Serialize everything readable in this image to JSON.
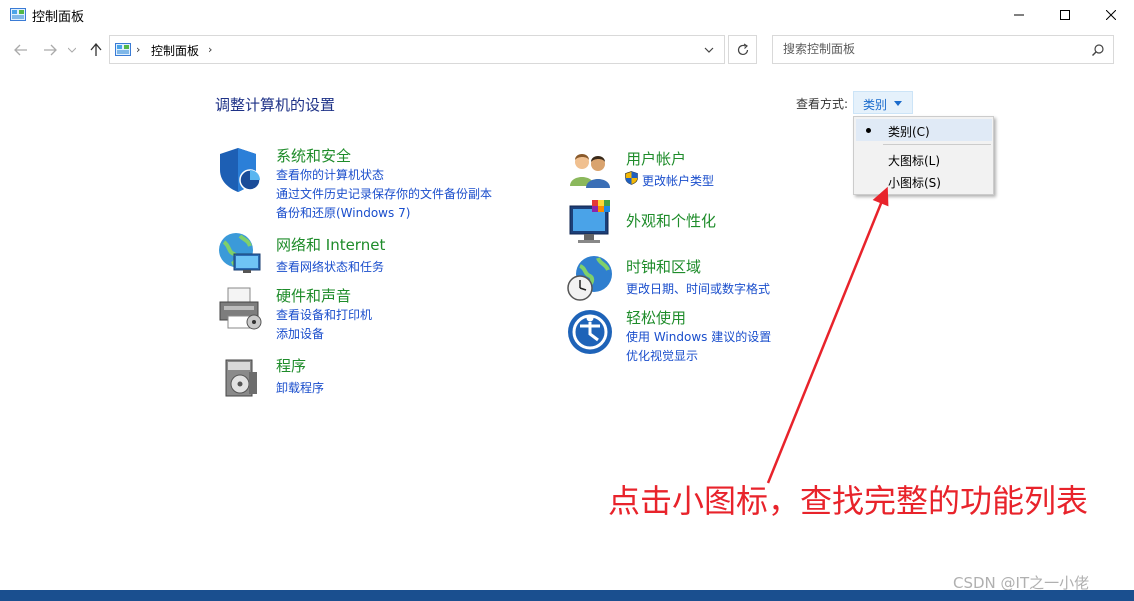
{
  "window": {
    "title": "控制面板",
    "icon": "control-panel-icon"
  },
  "nav": {
    "address_root": "控制面板",
    "search_placeholder": "搜索控制面板"
  },
  "main": {
    "heading": "调整计算机的设置",
    "view_label": "查看方式:",
    "view_value": "类别"
  },
  "view_menu": {
    "items": [
      {
        "label": "类别(C)",
        "selected": true
      },
      {
        "label": "大图标(L)",
        "selected": false
      },
      {
        "label": "小图标(S)",
        "selected": false
      }
    ]
  },
  "categories": {
    "system": {
      "title": "系统和安全",
      "icon": "shield-icon",
      "links": [
        "查看你的计算机状态",
        "通过文件历史记录保存你的文件备份副本",
        "备份和还原(Windows 7)"
      ]
    },
    "network": {
      "title": "网络和 Internet",
      "icon": "globe-network-icon",
      "links": [
        "查看网络状态和任务"
      ]
    },
    "hardware": {
      "title": "硬件和声音",
      "icon": "printer-icon",
      "links": [
        "查看设备和打印机",
        "添加设备"
      ]
    },
    "programs": {
      "title": "程序",
      "icon": "programs-disc-icon",
      "links": [
        "卸载程序"
      ]
    },
    "users": {
      "title": "用户帐户",
      "icon": "users-icon",
      "links": [
        "更改帐户类型"
      ]
    },
    "appearance": {
      "title": "外观和个性化",
      "icon": "monitor-palette-icon",
      "links": []
    },
    "clock": {
      "title": "时钟和区域",
      "icon": "clock-globe-icon",
      "links": [
        "更改日期、时间或数字格式"
      ]
    },
    "ease": {
      "title": "轻松使用",
      "icon": "ease-of-access-icon",
      "links": [
        "使用 Windows 建议的设置",
        "优化视觉显示"
      ]
    }
  },
  "annotation": {
    "text": "点击小图标，查找完整的功能列表",
    "color": "#e8232b"
  },
  "watermark": "CSDN @IT之一小佬",
  "colors": {
    "category_title": "#1e8c2a",
    "link": "#1a4ecc",
    "heading": "#1e3287"
  }
}
